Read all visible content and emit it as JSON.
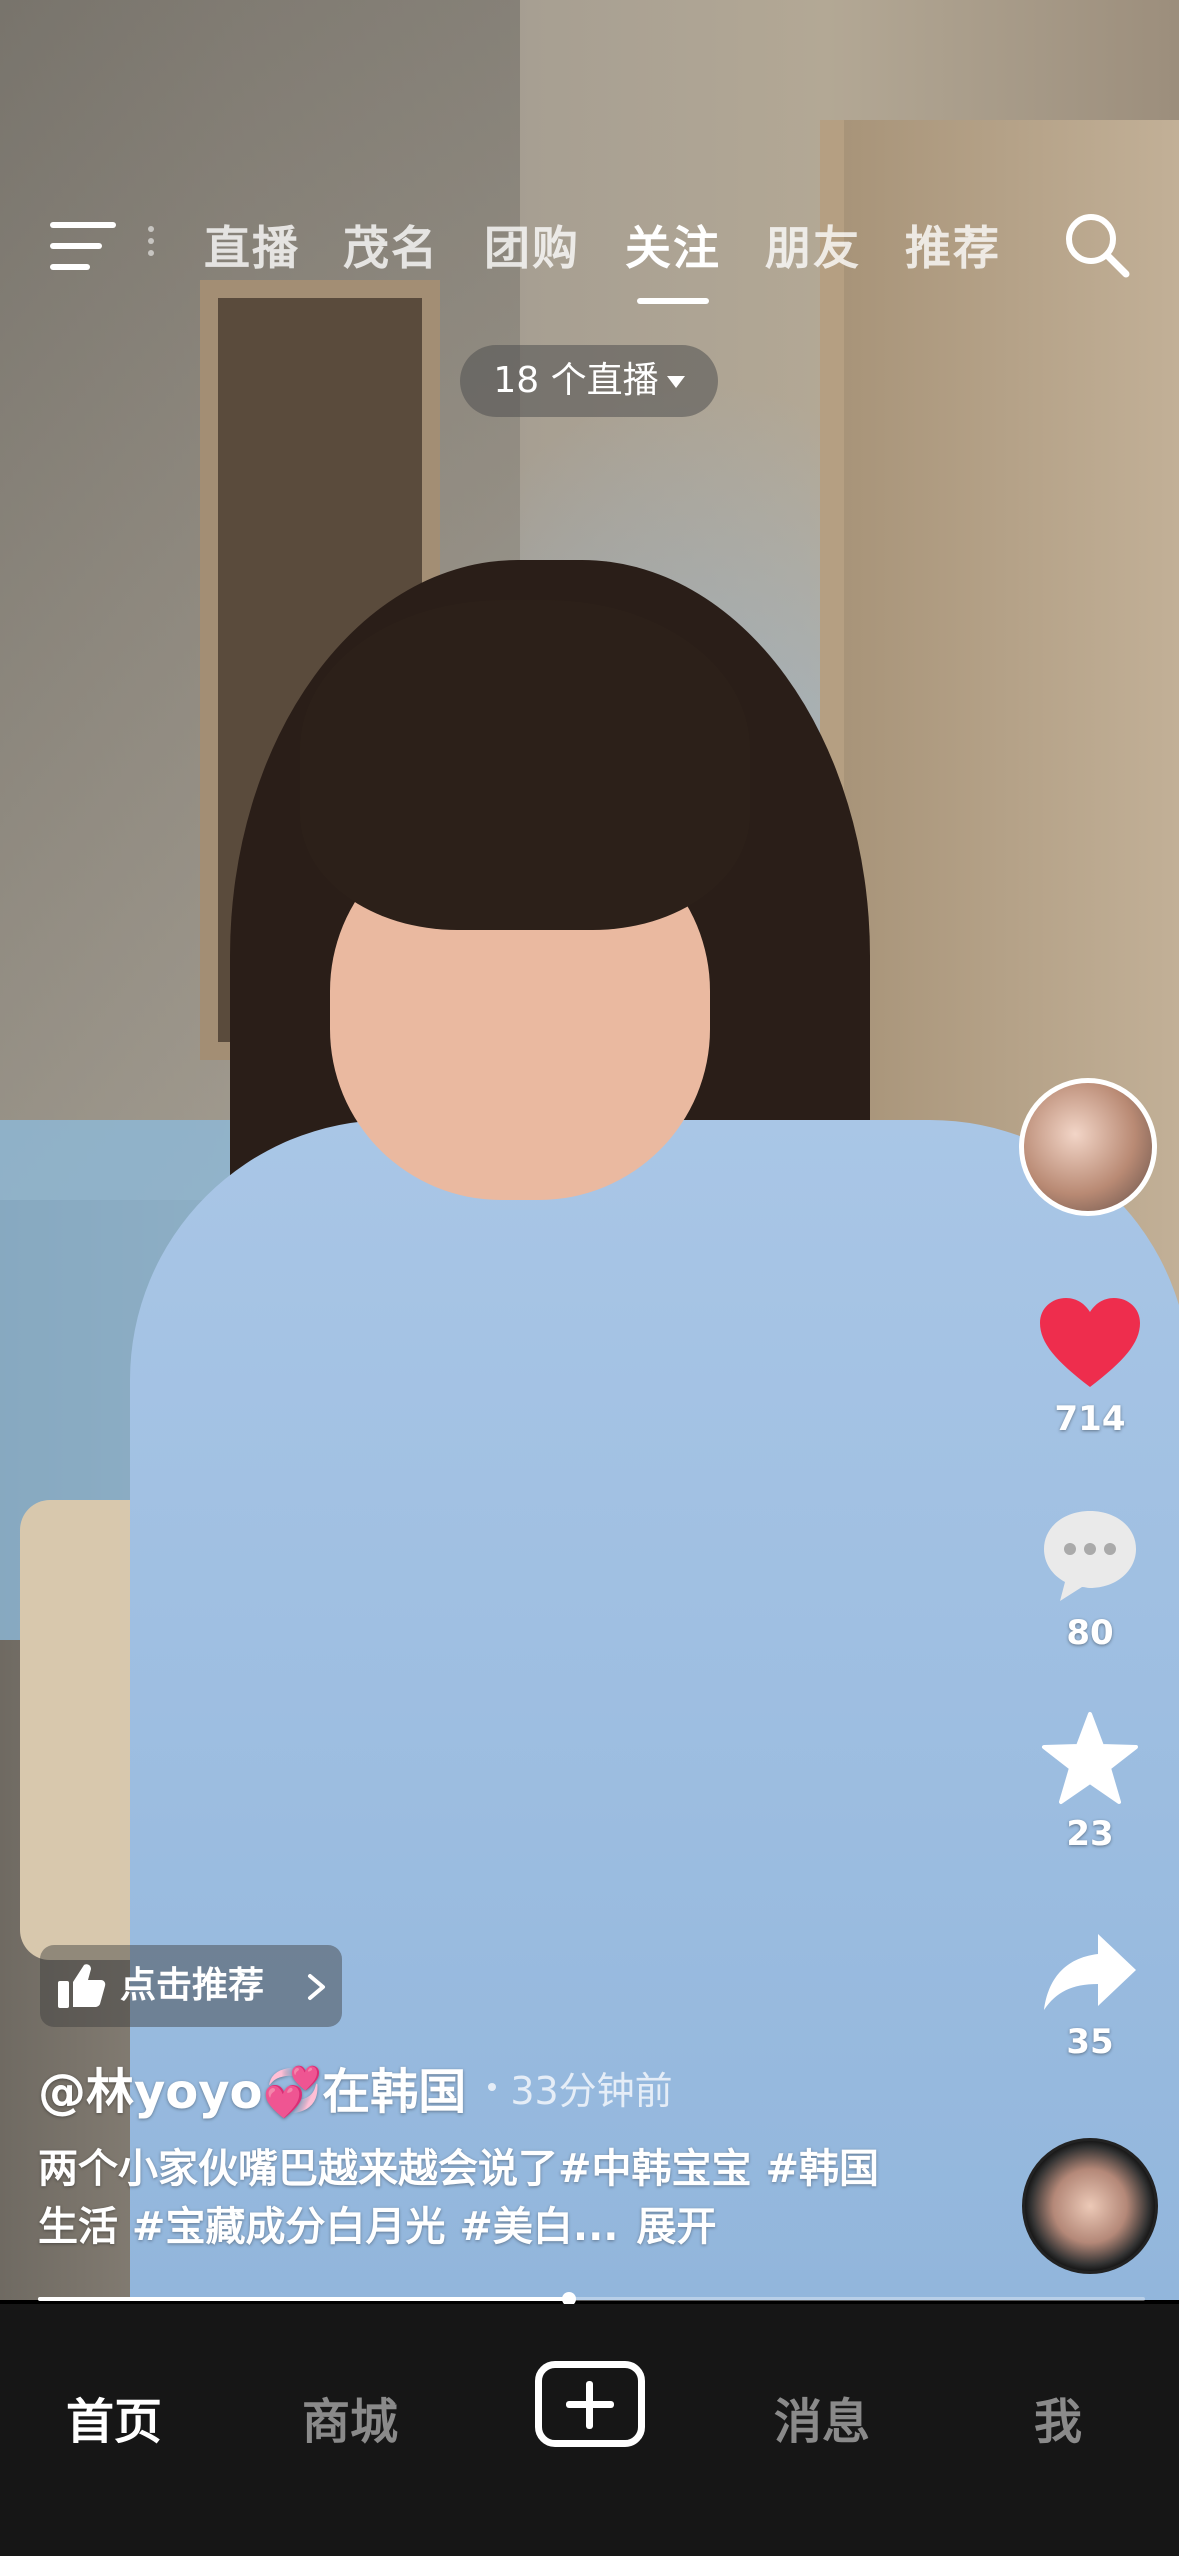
{
  "top_nav": {
    "tabs": [
      "直播",
      "茂名",
      "团购",
      "关注",
      "朋友",
      "推荐"
    ],
    "active_tab": "关注",
    "live_pill": "18 个直播"
  },
  "actions": {
    "like_count": "714",
    "comment_count": "80",
    "favorite_count": "23",
    "share_count": "35",
    "like_color": "#ee2d4d"
  },
  "post": {
    "recommend_label": "点击推荐",
    "author": "@林yoyo💞在韩国",
    "time_ago": "33分钟前",
    "caption": "两个小家伙嘴巴越来越会说了#中韩宝宝 #韩国生活 #宝藏成分白月光 #美白...",
    "expand_label": "展开",
    "progress": 0.48
  },
  "bottom_tabs": {
    "home": "首页",
    "mall": "商城",
    "messages": "消息",
    "me": "我",
    "active": "首页"
  }
}
